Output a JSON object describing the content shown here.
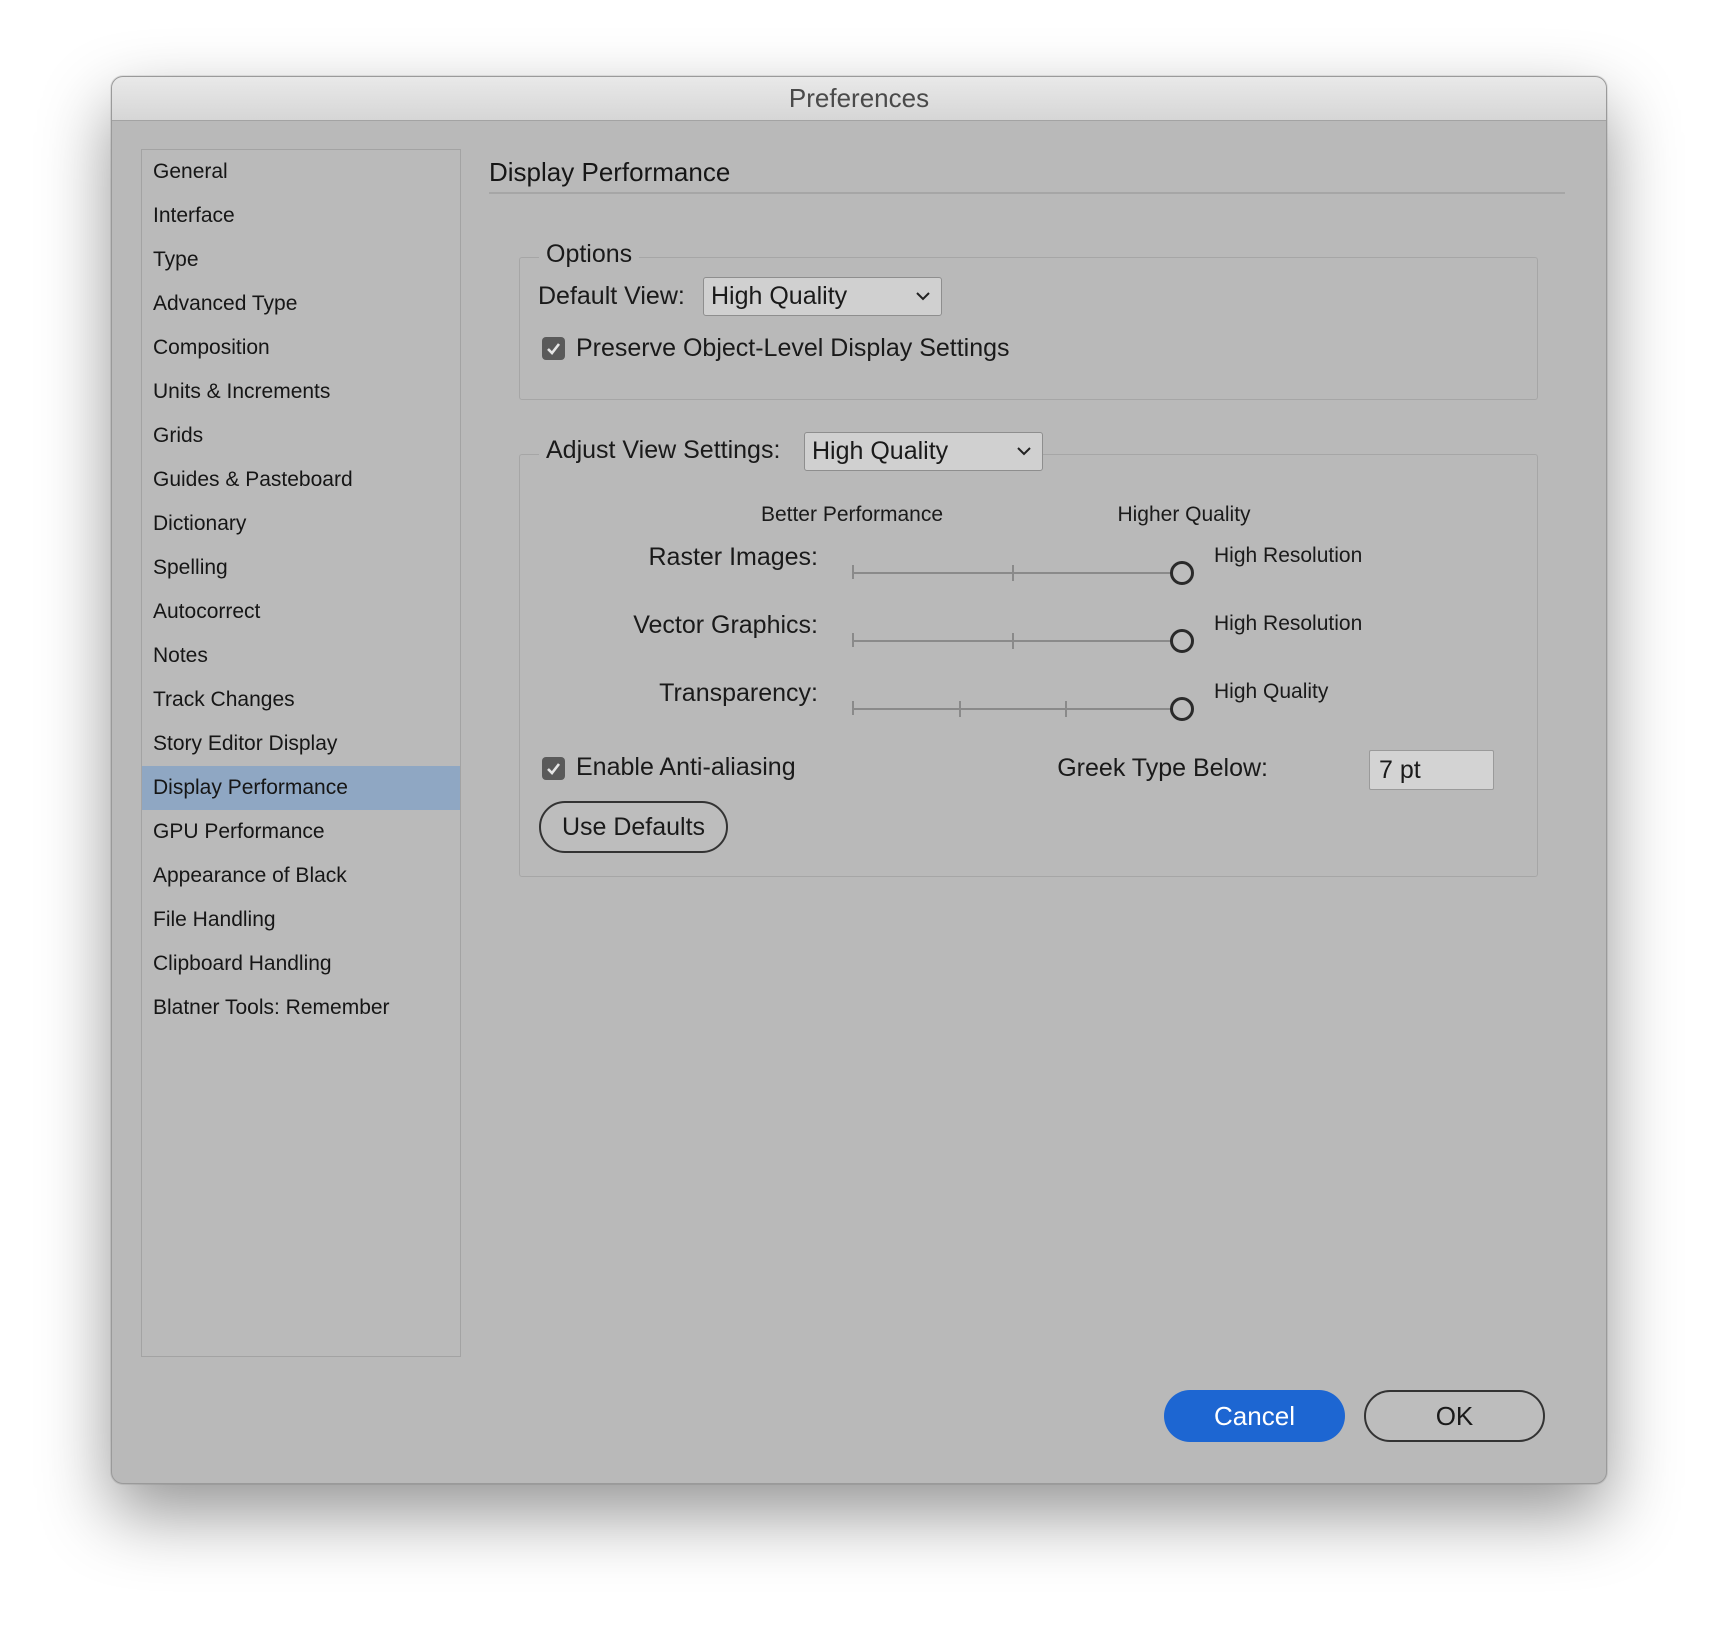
{
  "window": {
    "title": "Preferences"
  },
  "sidebar": {
    "selected_index": 14,
    "items": [
      {
        "label": "General"
      },
      {
        "label": "Interface"
      },
      {
        "label": "Type"
      },
      {
        "label": "Advanced Type"
      },
      {
        "label": "Composition"
      },
      {
        "label": "Units & Increments"
      },
      {
        "label": "Grids"
      },
      {
        "label": "Guides & Pasteboard"
      },
      {
        "label": "Dictionary"
      },
      {
        "label": "Spelling"
      },
      {
        "label": "Autocorrect"
      },
      {
        "label": "Notes"
      },
      {
        "label": "Track Changes"
      },
      {
        "label": "Story Editor Display"
      },
      {
        "label": "Display Performance"
      },
      {
        "label": "GPU Performance"
      },
      {
        "label": "Appearance of Black"
      },
      {
        "label": "File Handling"
      },
      {
        "label": "Clipboard Handling"
      },
      {
        "label": "Blatner Tools: Remember"
      }
    ]
  },
  "panel": {
    "title": "Display Performance",
    "options": {
      "legend": "Options",
      "default_view_label": "Default View:",
      "default_view_value": "High Quality",
      "preserve_label": "Preserve Object-Level Display Settings",
      "preserve_checked": true
    },
    "adjust": {
      "label": "Adjust View Settings:",
      "value": "High Quality",
      "scale_left": "Better Performance",
      "scale_right": "Higher Quality",
      "sliders": [
        {
          "label": "Raster Images:",
          "value_label": "High Resolution",
          "level": 1.0,
          "stops": 3
        },
        {
          "label": "Vector Graphics:",
          "value_label": "High Resolution",
          "level": 1.0,
          "stops": 3
        },
        {
          "label": "Transparency:",
          "value_label": "High Quality",
          "level": 1.0,
          "stops": 4
        }
      ],
      "antialias_label": "Enable Anti-aliasing",
      "antialias_checked": true,
      "greek_label": "Greek Type Below:",
      "greek_value": "7 pt",
      "defaults_button": "Use Defaults"
    }
  },
  "footer": {
    "cancel_label": "Cancel",
    "ok_label": "OK"
  },
  "colors": {
    "dialog_bg": "#b9b9b9",
    "selection": "#8fa7c3",
    "primary_button": "#1d66d2"
  }
}
